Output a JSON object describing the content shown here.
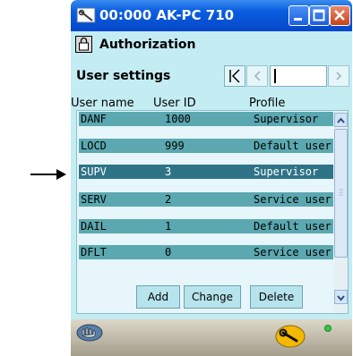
{
  "window": {
    "title": "00:000 AK-PC 710",
    "controls": [
      "minimize-icon",
      "maximize-icon",
      "close-icon"
    ]
  },
  "section": {
    "title": "Authorization",
    "icon": "lock-icon"
  },
  "page": {
    "title": "User settings",
    "nav_field_value": ""
  },
  "table": {
    "columns": [
      "User name",
      "User ID",
      "Profile"
    ],
    "rows": [
      {
        "name": "DANF",
        "id": "1000",
        "profile": "Supervisor"
      },
      {
        "name": "LOCD",
        "id": "999",
        "profile": "Default user"
      },
      {
        "name": "SUPV",
        "id": "3",
        "profile": "Supervisor",
        "selected": true
      },
      {
        "name": "SERV",
        "id": "2",
        "profile": "Service user"
      },
      {
        "name": "DAIL",
        "id": "1",
        "profile": "Default user"
      },
      {
        "name": "DFLT",
        "id": "0",
        "profile": "Service user"
      }
    ]
  },
  "buttons": {
    "add": "Add",
    "change": "Change",
    "delete": "Delete"
  },
  "status": {
    "left_icon": "hand-icon",
    "right_icon": "wrench-icon",
    "indicator": "led-icon",
    "indicator_color": "#2ecc40"
  },
  "colors": {
    "titlebar": "#0a5ee0",
    "panel": "#c4ecf3",
    "row": "#5ba8b0",
    "row_selected": "#2f7387"
  }
}
